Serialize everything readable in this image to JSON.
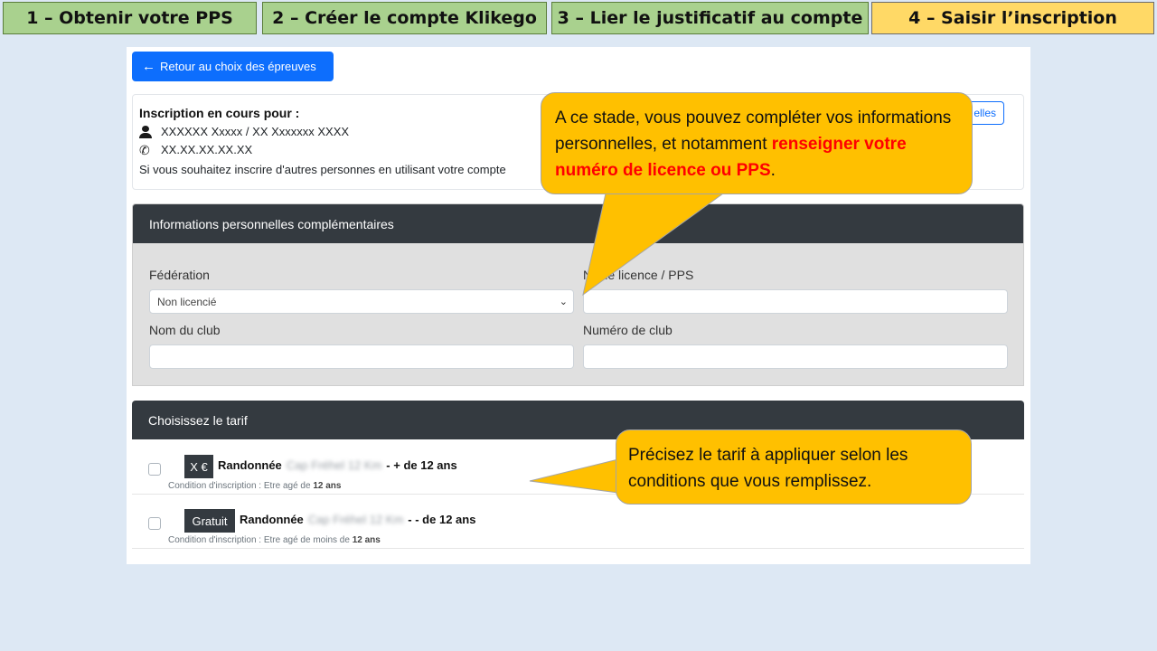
{
  "steps": [
    {
      "label": "1 – Obtenir votre PPS"
    },
    {
      "label": "2 – Créer le compte Klikego"
    },
    {
      "label": "3 – Lier le justificatif au compte"
    },
    {
      "label": "4 – Saisir l’inscription"
    }
  ],
  "back_button": {
    "label": "Retour au choix des épreuves",
    "icon": "arrow-left-icon"
  },
  "info": {
    "title": "Inscription en cours pour :",
    "name": "XXXXXX Xxxxx / XX Xxxxxxx XXXX",
    "phone": "XX.XX.XX.XX.XX",
    "note": "Si vous souhaitez inscrire d'autres personnes en utilisant votre compte",
    "outline_button_partial": "elles"
  },
  "perso": {
    "header": "Informations personnelles complémentaires",
    "federation_label": "Fédération",
    "federation_value": "Non licencié",
    "licence_label": "N° de licence / PPS",
    "licence_value": "",
    "club_name_label": "Nom du club",
    "club_name_value": "",
    "club_number_label": "Numéro de club",
    "club_number_value": ""
  },
  "tarif": {
    "header": "Choisissez le tarif",
    "items": [
      {
        "price": "X €",
        "name": "Randonnée",
        "hidden": "Cap Fréhel 12 Km",
        "suffix": "- + de 12 ans",
        "condition": "Condition d'inscription : Etre agé de",
        "condition_value": "12 ans"
      },
      {
        "price": "Gratuit",
        "name": "Randonnée",
        "hidden": "Cap Fréhel 12 Km",
        "suffix": "- - de 12 ans",
        "condition": "Condition d'inscription : Etre agé de moins de",
        "condition_value": "12 ans"
      }
    ]
  },
  "callouts": {
    "c1_text": "A ce stade, vous pouvez compléter vos informations personnelles, et notamment",
    "c1_highlight": "renseigner votre numéro de licence ou PPS",
    "c1_end": ".",
    "c2_text": "Précisez le tarif à appliquer selon les conditions que vous remplissez."
  },
  "colors": {
    "step_done": "#a9d18e",
    "step_active": "#ffd966",
    "callout": "#ffc000",
    "primary": "#0d6efd",
    "dark_header": "#343a40"
  }
}
